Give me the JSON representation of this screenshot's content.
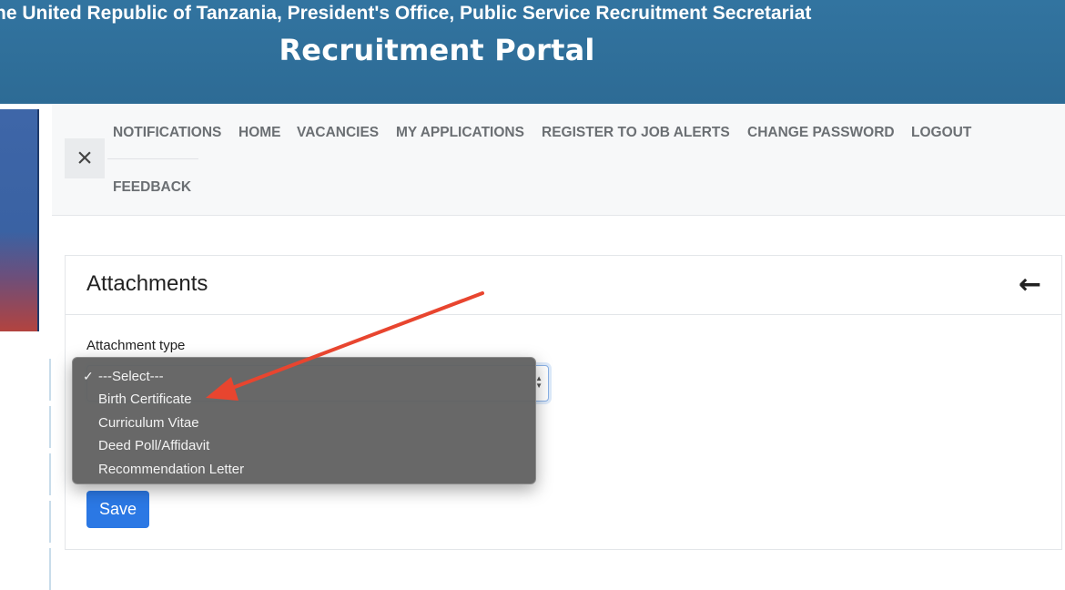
{
  "banner": {
    "line1": "he United Republic of Tanzania, President's Office, Public Service Recruitment Secretariat",
    "title": "Recruitment Portal"
  },
  "nav": {
    "items": [
      {
        "label": "NOTIFICATIONS"
      },
      {
        "label": "HOME"
      },
      {
        "label": "VACANCIES"
      },
      {
        "label": "MY APPLICATIONS"
      },
      {
        "label": "REGISTER TO JOB ALERTS"
      },
      {
        "label": "CHANGE PASSWORD"
      },
      {
        "label": "LOGOUT"
      },
      {
        "label": "FEEDBACK"
      }
    ],
    "close_icon": "close-icon"
  },
  "card": {
    "title": "Attachments",
    "back_icon": "arrow-left-icon",
    "field_label": "Attachment type",
    "save_label": "Save"
  },
  "dropdown": {
    "selected": "---Select---",
    "options": [
      {
        "label": "---Select---",
        "checked": true
      },
      {
        "label": "Birth Certificate"
      },
      {
        "label": "Curriculum Vitae"
      },
      {
        "label": "Deed Poll/Affidavit"
      },
      {
        "label": "Recommendation Letter"
      }
    ]
  },
  "colors": {
    "banner": "#2f6f99",
    "primary_button": "#2b78e4",
    "annotation_arrow": "#e8452f"
  }
}
